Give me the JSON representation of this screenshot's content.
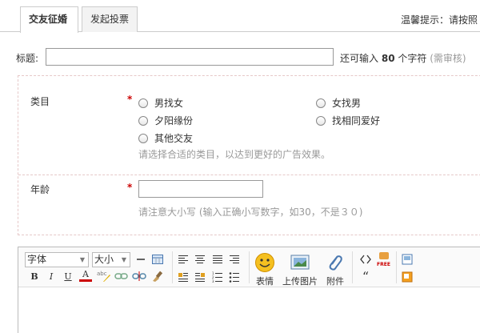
{
  "tabs": [
    {
      "label": "交友征婚"
    },
    {
      "label": "发起投票"
    }
  ],
  "tip": "温馨提示：请按照",
  "title_field": {
    "label": "标题:",
    "value": "",
    "hint_prefix": "还可输入",
    "hint_count": "80",
    "hint_suffix": "个字符",
    "hint_note": "(需审核)"
  },
  "category": {
    "label": "类目",
    "required": "*",
    "options": [
      {
        "label": "男找女"
      },
      {
        "label": "女找男"
      },
      {
        "label": "夕阳缘份"
      },
      {
        "label": "找相同爱好"
      },
      {
        "label": "其他交友"
      }
    ],
    "help": "请选择合适的类目，以达到更好的广告效果。"
  },
  "age": {
    "label": "年龄",
    "required": "*",
    "value": "",
    "help": "请注意大小写 (输入正确小写数字，如30，不是３０)"
  },
  "editor": {
    "font_select": "字体",
    "size_select": "大小",
    "emoticon_label": "表情",
    "upload_image_label": "上传图片",
    "attachment_label": "附件",
    "bold": "B",
    "italic": "I",
    "underline": "U",
    "font_color": "A",
    "quote": "“",
    "free_badge": "FREE",
    "accent_color": "#cc0000"
  }
}
